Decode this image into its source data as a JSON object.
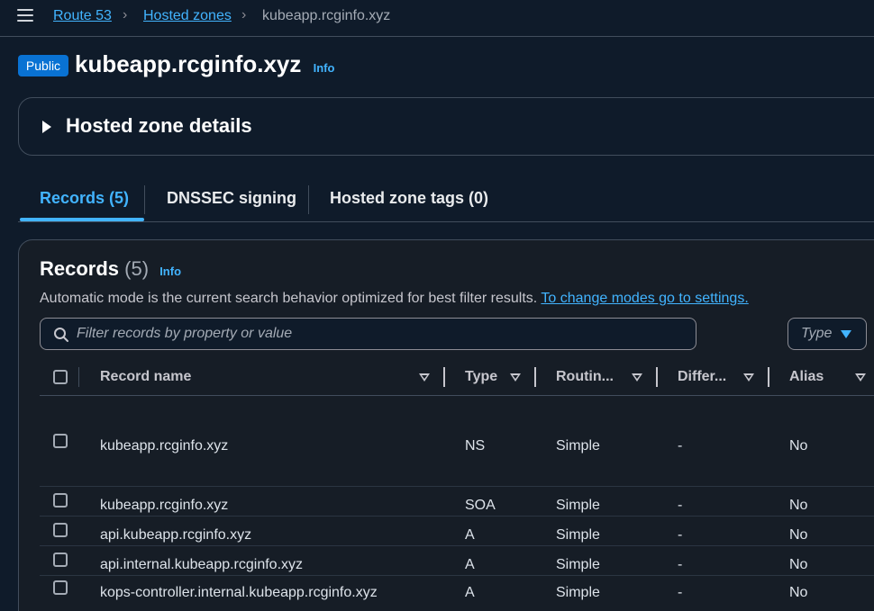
{
  "breadcrumb": {
    "items": [
      {
        "label": "Route 53"
      },
      {
        "label": "Hosted zones"
      },
      {
        "label": "kubeapp.rcginfo.xyz"
      }
    ]
  },
  "header": {
    "badge": "Public",
    "title": "kubeapp.rcginfo.xyz",
    "info": "Info"
  },
  "details": {
    "title": "Hosted zone details"
  },
  "tabs": [
    {
      "label": "Records (5)",
      "active": true
    },
    {
      "label": "DNSSEC signing",
      "active": false
    },
    {
      "label": "Hosted zone tags (0)",
      "active": false
    }
  ],
  "records": {
    "title": "Records",
    "count": "(5)",
    "info": "Info",
    "description": "Automatic mode is the current search behavior optimized for best filter results.",
    "settings_link": "To change modes go to settings.",
    "search_placeholder": "Filter records by property or value",
    "type_filter": "Type",
    "columns": [
      "Record name",
      "Type",
      "Routin...",
      "Differ...",
      "Alias"
    ],
    "rows": [
      {
        "name": "kubeapp.rcginfo.xyz",
        "type": "NS",
        "routing": "Simple",
        "differ": "-",
        "alias": "No"
      },
      {
        "name": "kubeapp.rcginfo.xyz",
        "type": "SOA",
        "routing": "Simple",
        "differ": "-",
        "alias": "No"
      },
      {
        "name": "api.kubeapp.rcginfo.xyz",
        "type": "A",
        "routing": "Simple",
        "differ": "-",
        "alias": "No"
      },
      {
        "name": "api.internal.kubeapp.rcginfo.xyz",
        "type": "A",
        "routing": "Simple",
        "differ": "-",
        "alias": "No"
      },
      {
        "name": "kops-controller.internal.kubeapp.rcginfo.xyz",
        "type": "A",
        "routing": "Simple",
        "differ": "-",
        "alias": "No"
      }
    ]
  },
  "colors": {
    "background": "#0f1b2a",
    "panel": "#161d26",
    "accent": "#42b4ff",
    "badge": "#0972d3",
    "border": "#414d5c"
  }
}
